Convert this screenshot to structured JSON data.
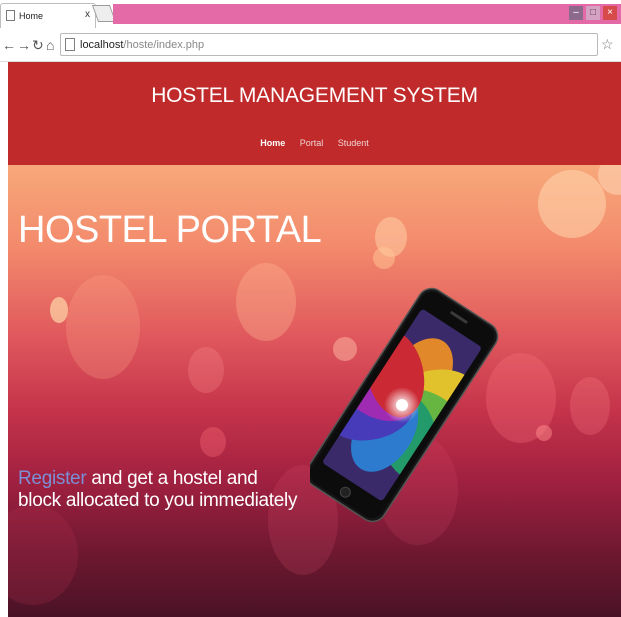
{
  "browser": {
    "tab_title": "Home",
    "tab_close": "x",
    "url_host": "localhost",
    "url_path": "/hoste/index.php",
    "nav_icons": [
      "back-arrow-icon",
      "forward-arrow-icon",
      "reload-icon",
      "home-icon"
    ],
    "star_icon": "star-icon",
    "menu_icon": "menu-icon"
  },
  "header": {
    "site_title": "HOSTEL MANAGEMENT SYSTEM",
    "nav": [
      {
        "label": "Home",
        "active": true
      },
      {
        "label": "Portal",
        "active": false
      },
      {
        "label": "Student",
        "active": false
      }
    ]
  },
  "hero": {
    "title": "HOSTEL PORTAL",
    "tagline_link": "Register",
    "tagline_line1_rest": " and get a hostel and",
    "tagline_line2": "block allocated to you immediately"
  },
  "colors": {
    "header_bg": "#c02a2a",
    "tab_strip": "#e469a7",
    "register_link": "#7b8fd6",
    "hero_top": "#f7a87a",
    "hero_bottom": "#4a1226"
  }
}
